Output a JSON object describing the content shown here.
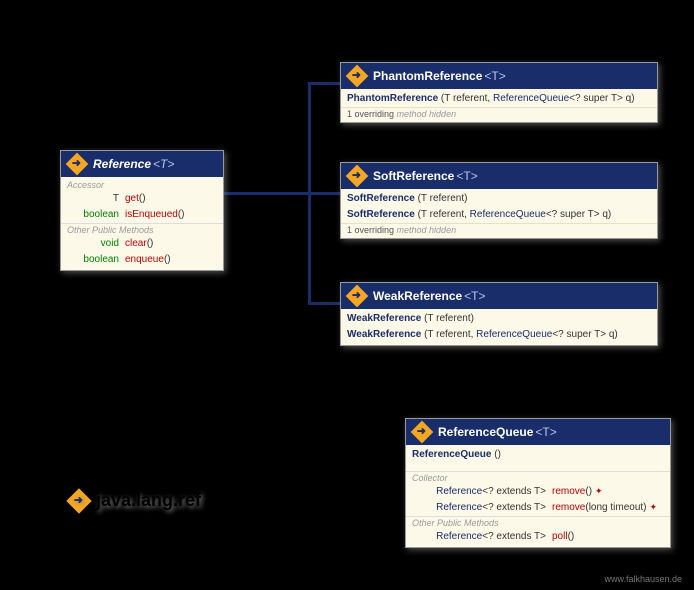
{
  "package": {
    "name": "java.lang.ref"
  },
  "footer": "www.falkhausen.de",
  "reference": {
    "title": "Reference",
    "generic": "<T>",
    "sections": {
      "accessor": "Accessor",
      "other": "Other Public Methods"
    },
    "rows": {
      "get": {
        "ret": "T",
        "name": "get",
        "params": "()"
      },
      "isEnqueued": {
        "ret": "boolean",
        "name": "isEnqueued",
        "params": "()"
      },
      "clear": {
        "ret": "void",
        "name": "clear",
        "params": "()"
      },
      "enqueue": {
        "ret": "boolean",
        "name": "enqueue",
        "params": "()"
      }
    }
  },
  "phantom": {
    "title": "PhantomReference",
    "generic": "<T>",
    "ctor_p1": "(T referent, ",
    "ctor_link": "ReferenceQueue",
    "ctor_p2": "<? super T> q)",
    "note_num": "1 overriding",
    "note_rest": " method hidden"
  },
  "soft": {
    "title": "SoftReference",
    "generic": "<T>",
    "ctor1_name": "SoftReference",
    "ctor1_params": "(T referent)",
    "ctor2_name": "SoftReference",
    "ctor2_p1": "(T referent, ",
    "ctor2_link": "ReferenceQueue",
    "ctor2_p2": "<? super T> q)",
    "note_num": "1 overriding",
    "note_rest": " method hidden"
  },
  "weak": {
    "title": "WeakReference",
    "generic": "<T>",
    "ctor1_name": "WeakReference",
    "ctor1_params": "(T referent)",
    "ctor2_name": "WeakReference",
    "ctor2_p1": "(T referent, ",
    "ctor2_link": "ReferenceQueue",
    "ctor2_p2": "<? super T> q)"
  },
  "queue": {
    "title": "ReferenceQueue",
    "generic": "<T>",
    "ctor_name": "ReferenceQueue",
    "ctor_params": "()",
    "sections": {
      "collector": "Collector",
      "other": "Other Public Methods"
    },
    "rows": {
      "remove1": {
        "ret_link": "Reference",
        "ret_rest": "<? extends T>",
        "name": "remove",
        "params": "()",
        "throws": "✦"
      },
      "remove2": {
        "ret_link": "Reference",
        "ret_rest": "<? extends T>",
        "name": "remove",
        "params": "(long timeout)",
        "throws": "✦"
      },
      "poll": {
        "ret_link": "Reference",
        "ret_rest": "<? extends T>",
        "name": "poll",
        "params": "()"
      }
    }
  }
}
